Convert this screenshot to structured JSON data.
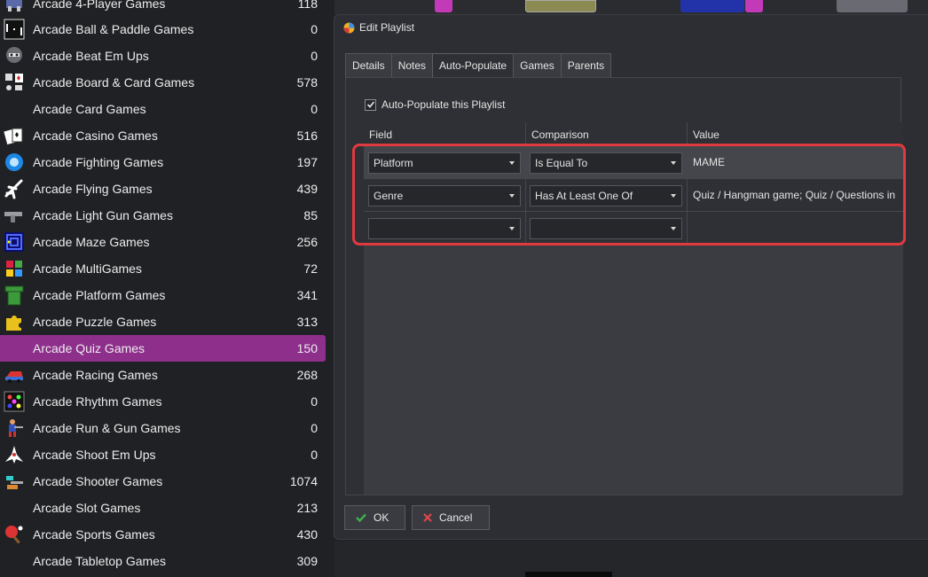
{
  "playlists": [
    {
      "label": "Arcade 4-Player Games",
      "count": "118",
      "icon": "four-player-icon"
    },
    {
      "label": "Arcade Ball & Paddle Games",
      "count": "0",
      "icon": "paddle-icon"
    },
    {
      "label": "Arcade Beat Em Ups",
      "count": "0",
      "icon": "brawler-icon"
    },
    {
      "label": "Arcade Board & Card Games",
      "count": "578",
      "icon": "board-card-icon"
    },
    {
      "label": "Arcade Card Games",
      "count": "0",
      "icon": ""
    },
    {
      "label": "Arcade Casino Games",
      "count": "516",
      "icon": "cards-icon"
    },
    {
      "label": "Arcade Fighting Games",
      "count": "197",
      "icon": "fireball-icon"
    },
    {
      "label": "Arcade Flying Games",
      "count": "439",
      "icon": "airplane-icon"
    },
    {
      "label": "Arcade Light Gun Games",
      "count": "85",
      "icon": "light-gun-icon"
    },
    {
      "label": "Arcade Maze Games",
      "count": "256",
      "icon": "maze-icon"
    },
    {
      "label": "Arcade MultiGames",
      "count": "72",
      "icon": "multigame-icon"
    },
    {
      "label": "Arcade Platform Games",
      "count": "341",
      "icon": "pipe-icon"
    },
    {
      "label": "Arcade Puzzle Games",
      "count": "313",
      "icon": "puzzle-icon"
    },
    {
      "label": "Arcade Quiz Games",
      "count": "150",
      "icon": ""
    },
    {
      "label": "Arcade Racing Games",
      "count": "268",
      "icon": "racing-icon"
    },
    {
      "label": "Arcade Rhythm Games",
      "count": "0",
      "icon": "rhythm-icon"
    },
    {
      "label": "Arcade Run & Gun Games",
      "count": "0",
      "icon": "soldier-icon"
    },
    {
      "label": "Arcade Shoot Em Ups",
      "count": "0",
      "icon": "spaceship-icon"
    },
    {
      "label": "Arcade Shooter Games",
      "count": "1074",
      "icon": "shooter-icon"
    },
    {
      "label": "Arcade Slot Games",
      "count": "213",
      "icon": ""
    },
    {
      "label": "Arcade Sports Games",
      "count": "430",
      "icon": "ping-pong-icon"
    },
    {
      "label": "Arcade Tabletop Games",
      "count": "309",
      "icon": ""
    }
  ],
  "selected_playlist": "Arcade Quiz Games",
  "colors": {
    "selected": "#8e2f8c",
    "highlight": "#e0393e",
    "ok_check": "#3fb950",
    "cancel_x": "#e5484d"
  },
  "dialog": {
    "title": "Edit Playlist",
    "tabs": [
      {
        "label": "Details",
        "active": false
      },
      {
        "label": "Notes",
        "active": false
      },
      {
        "label": "Auto-Populate",
        "active": true
      },
      {
        "label": "Games",
        "active": false
      },
      {
        "label": "Parents",
        "active": false
      }
    ],
    "checkbox_label": "Auto-Populate this Playlist",
    "checkbox_checked": true,
    "columns": [
      "Field",
      "Comparison",
      "Value"
    ],
    "rules": [
      {
        "field": "Platform",
        "comparison": "Is Equal To",
        "value": "MAME"
      },
      {
        "field": "Genre",
        "comparison": "Has At Least One Of",
        "value": "Quiz / Hangman game; Quiz / Questions in"
      },
      {
        "field": "",
        "comparison": "",
        "value": ""
      }
    ],
    "ok_label": "OK",
    "cancel_label": "Cancel"
  }
}
